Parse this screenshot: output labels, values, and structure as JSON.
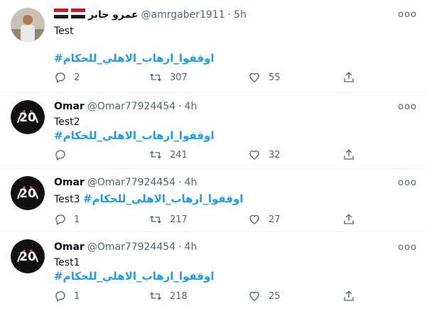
{
  "tweets": [
    {
      "name": "عمرو جابر",
      "handle": "@amrgaber1911",
      "time": "5h",
      "text": "Test",
      "hashtag": "#اوقفوا_ارهاب_الاهلي_للحكام",
      "replies": "2",
      "retweets": "307",
      "likes": "55"
    },
    {
      "name": "Omar",
      "handle": "@Omar77924454",
      "time": "4h",
      "text": "Test2",
      "hashtag": "#اوقفوا_ارهاب_الاهلي_للحكام",
      "replies": "",
      "retweets": "241",
      "likes": "32"
    },
    {
      "name": "Omar",
      "handle": "@Omar77924454",
      "time": "4h",
      "text": "Test3",
      "hashtag": "#اوقفوا_ارهاب_الاهلي_للحكام",
      "replies": "1",
      "retweets": "217",
      "likes": "27"
    },
    {
      "name": "Omar",
      "handle": "@Omar77924454",
      "time": "4h",
      "text": "Test1",
      "hashtag": "#اوقفوا_ارهاب_الاهلي_للحكام",
      "replies": "1",
      "retweets": "218",
      "likes": "25"
    }
  ],
  "separator": "·",
  "more_glyph": "ooo",
  "colors": {
    "link": "#1d9bf0",
    "muted": "#536471",
    "text": "#0f1419"
  },
  "icons": [
    "reply-icon",
    "retweet-icon",
    "like-icon",
    "share-icon",
    "more-icon",
    "egypt-flag-icon"
  ]
}
